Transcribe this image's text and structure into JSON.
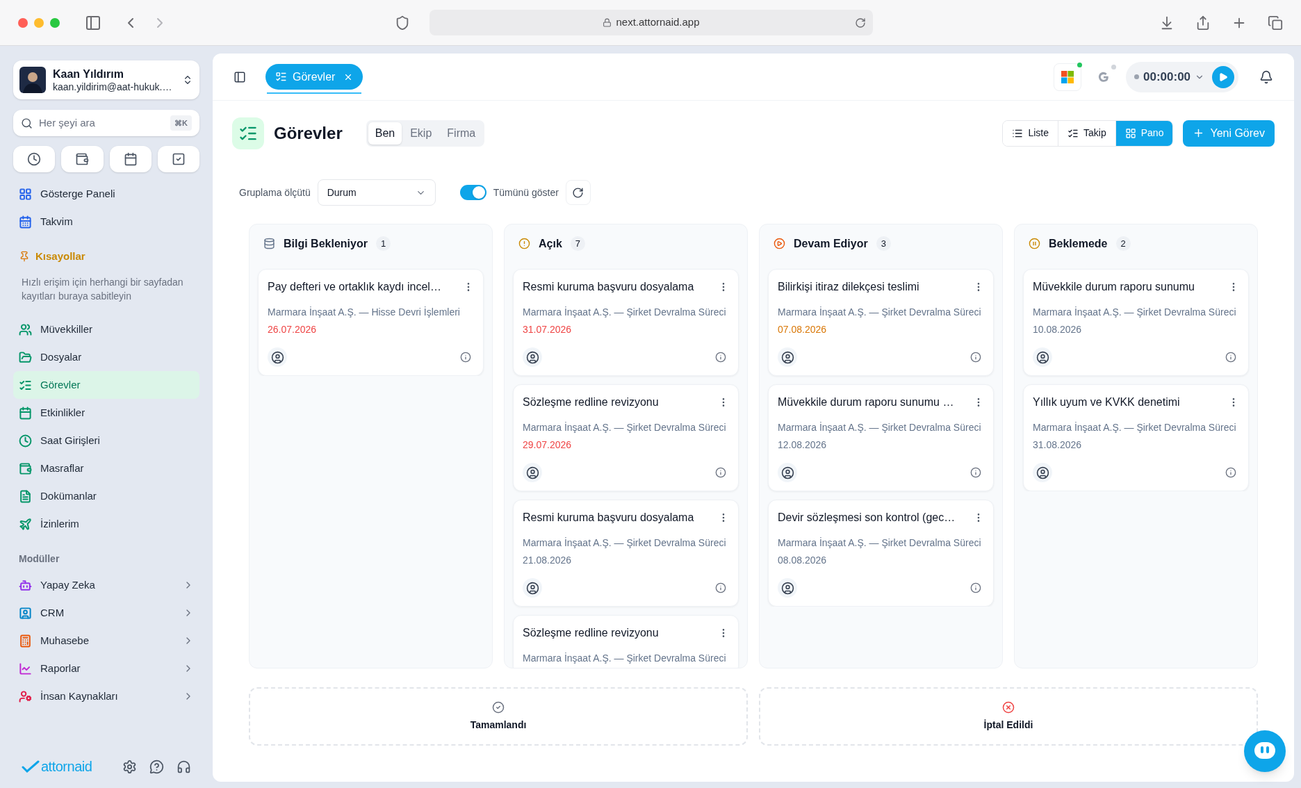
{
  "browser": {
    "url": "next.attornaid.app"
  },
  "user": {
    "name": "Kaan Yıldırım",
    "email": "kaan.yildirim@aat-hukuk.…"
  },
  "search": {
    "placeholder": "Her şeyi ara",
    "shortcut": "⌘K"
  },
  "nav_top": [
    {
      "label": "Gösterge Paneli",
      "color": "#2563eb",
      "selected": false
    },
    {
      "label": "Takvim",
      "color": "#2563eb",
      "selected": false
    }
  ],
  "shortcuts": {
    "title": "Kısayollar",
    "hint": "Hızlı erişim için herhangi bir sayfadan kayıtları buraya sabitleyin"
  },
  "nav_main": [
    {
      "label": "Müvekkiller",
      "color": "#059669",
      "selected": false
    },
    {
      "label": "Dosyalar",
      "color": "#059669",
      "selected": false
    },
    {
      "label": "Görevler",
      "color": "#059669",
      "selected": true
    },
    {
      "label": "Etkinlikler",
      "color": "#059669",
      "selected": false
    },
    {
      "label": "Saat Girişleri",
      "color": "#059669",
      "selected": false
    },
    {
      "label": "Masraflar",
      "color": "#059669",
      "selected": false
    },
    {
      "label": "Dokümanlar",
      "color": "#059669",
      "selected": false
    },
    {
      "label": "İzinlerim",
      "color": "#059669",
      "selected": false
    }
  ],
  "modules": {
    "title": "Modüller",
    "items": [
      {
        "label": "Yapay Zeka",
        "color": "#9333ea",
        "selected": false
      },
      {
        "label": "CRM",
        "color": "#0284c7",
        "selected": false
      },
      {
        "label": "Muhasebe",
        "color": "#ea580c",
        "selected": false
      },
      {
        "label": "Raporlar",
        "color": "#c026d3",
        "selected": false
      },
      {
        "label": "İnsan Kaynakları",
        "color": "#e11d48",
        "selected": false
      }
    ]
  },
  "brand": "attornaid",
  "open_tabs": [
    {
      "label": "Görevler",
      "selected": true
    }
  ],
  "timer": {
    "time": "00:00:00"
  },
  "page": {
    "title": "Görevler",
    "scopes": [
      {
        "label": "Ben",
        "selected": true
      },
      {
        "label": "Ekip",
        "selected": false
      },
      {
        "label": "Firma",
        "selected": false
      }
    ],
    "views": [
      {
        "label": "Liste",
        "selected": false
      },
      {
        "label": "Takip",
        "selected": false
      },
      {
        "label": "Pano",
        "selected": true
      }
    ],
    "new_button": "Yeni Görev"
  },
  "filters": {
    "group_label": "Gruplama ölçütü",
    "group_value": "Durum",
    "show_all": {
      "label": "Tümünü göster",
      "on": true
    }
  },
  "columns": [
    {
      "title": "Bilgi Bekleniyor",
      "count": "1",
      "cards": [
        {
          "title": "Pay defteri ve ortaklık kaydı incel…",
          "project": "Marmara İnşaat A.Ş. — Hisse Devri İşlemleri",
          "date": "26.07.2026",
          "color": "#ef4444"
        }
      ]
    },
    {
      "title": "Açık",
      "count": "7",
      "cards": [
        {
          "title": "Resmi kuruma başvuru dosyalama",
          "project": "Marmara İnşaat A.Ş. — Şirket Devralma Süreci",
          "date": "31.07.2026",
          "color": "#ef4444"
        },
        {
          "title": "Sözleşme redline revizyonu",
          "project": "Marmara İnşaat A.Ş. — Şirket Devralma Süreci",
          "date": "29.07.2026",
          "color": "#ef4444"
        },
        {
          "title": "Resmi kuruma başvuru dosyalama",
          "project": "Marmara İnşaat A.Ş. — Şirket Devralma Süreci",
          "date": "21.08.2026",
          "color": "#64748b"
        },
        {
          "title": "Sözleşme redline revizyonu",
          "project": "Marmara İnşaat A.Ş. — Şirket Devralma Süreci"
        }
      ]
    },
    {
      "title": "Devam Ediyor",
      "count": "3",
      "cards": [
        {
          "title": "Bilirkişi itiraz dilekçesi teslimi",
          "project": "Marmara İnşaat A.Ş. — Şirket Devralma Süreci",
          "date": "07.08.2026",
          "color": "#d97706"
        },
        {
          "title": "Müvekkile durum raporu sunumu …",
          "project": "Marmara İnşaat A.Ş. — Şirket Devralma Süreci",
          "date": "12.08.2026",
          "color": "#64748b"
        },
        {
          "title": "Devir sözleşmesi son kontrol (gec…",
          "project": "Marmara İnşaat A.Ş. — Şirket Devralma Süreci",
          "date": "08.08.2026",
          "color": "#64748b"
        }
      ]
    },
    {
      "title": "Beklemede",
      "count": "2",
      "cards": [
        {
          "title": "Müvekkile durum raporu sunumu",
          "project": "Marmara İnşaat A.Ş. — Şirket Devralma Süreci",
          "date": "10.08.2026",
          "color": "#64748b"
        },
        {
          "title": "Yıllık uyum ve KVKK denetimi",
          "project": "Marmara İnşaat A.Ş. — Şirket Devralma Süreci",
          "date": "31.08.2026",
          "color": "#64748b"
        }
      ]
    }
  ],
  "drop_zones": [
    {
      "label": "Tamamlandı",
      "kind": "done"
    },
    {
      "label": "İptal Edildi",
      "kind": "cancelled"
    }
  ]
}
